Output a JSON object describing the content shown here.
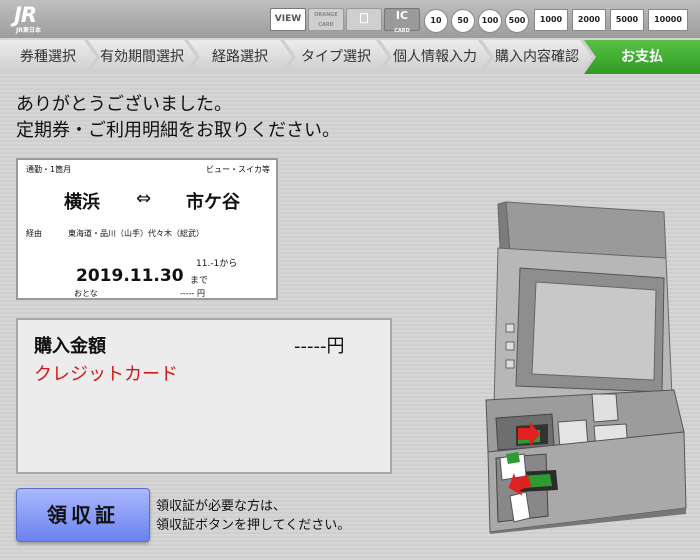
{
  "header": {
    "logo_text": "JR",
    "logo_sub": "JR東日本",
    "cards": [
      "VIEW",
      "ORANGE CARD",
      "IO",
      "IC CARD"
    ],
    "coins": [
      "10",
      "50",
      "100",
      "500"
    ],
    "bills": [
      "1000",
      "2000",
      "5000",
      "10000"
    ]
  },
  "steps": [
    "券種選択",
    "有効期間選択",
    "経路選択",
    "タイプ選択",
    "個人情報入力",
    "購入内容確認",
    "お支払"
  ],
  "instruction": {
    "line1": "ありがとうございました。",
    "line2": "定期券・ご利用明細をお取りください。"
  },
  "ticket": {
    "type": "通勤・1箇月",
    "brand": "ビュー・スイカ等",
    "from": "横浜",
    "arrow": "⇔",
    "to": "市ケ谷",
    "route_label": "経由",
    "route": "東海道・品川（山手）代々木（総武）",
    "start": "11.-1から",
    "end_date": "2019.11.30",
    "until": "まで",
    "passenger": "おとな",
    "price": "----- 円"
  },
  "purchase": {
    "label": "購入金額",
    "amount": "-----円",
    "method": "クレジットカード"
  },
  "receipt": {
    "button": "領収証",
    "note1": "領収証が必要な方は、",
    "note2": "領収証ボタンを押してください。"
  },
  "colors": {
    "active_step": "#3aa82b",
    "method_text": "#d01818",
    "receipt_button": "#7f93f2"
  }
}
